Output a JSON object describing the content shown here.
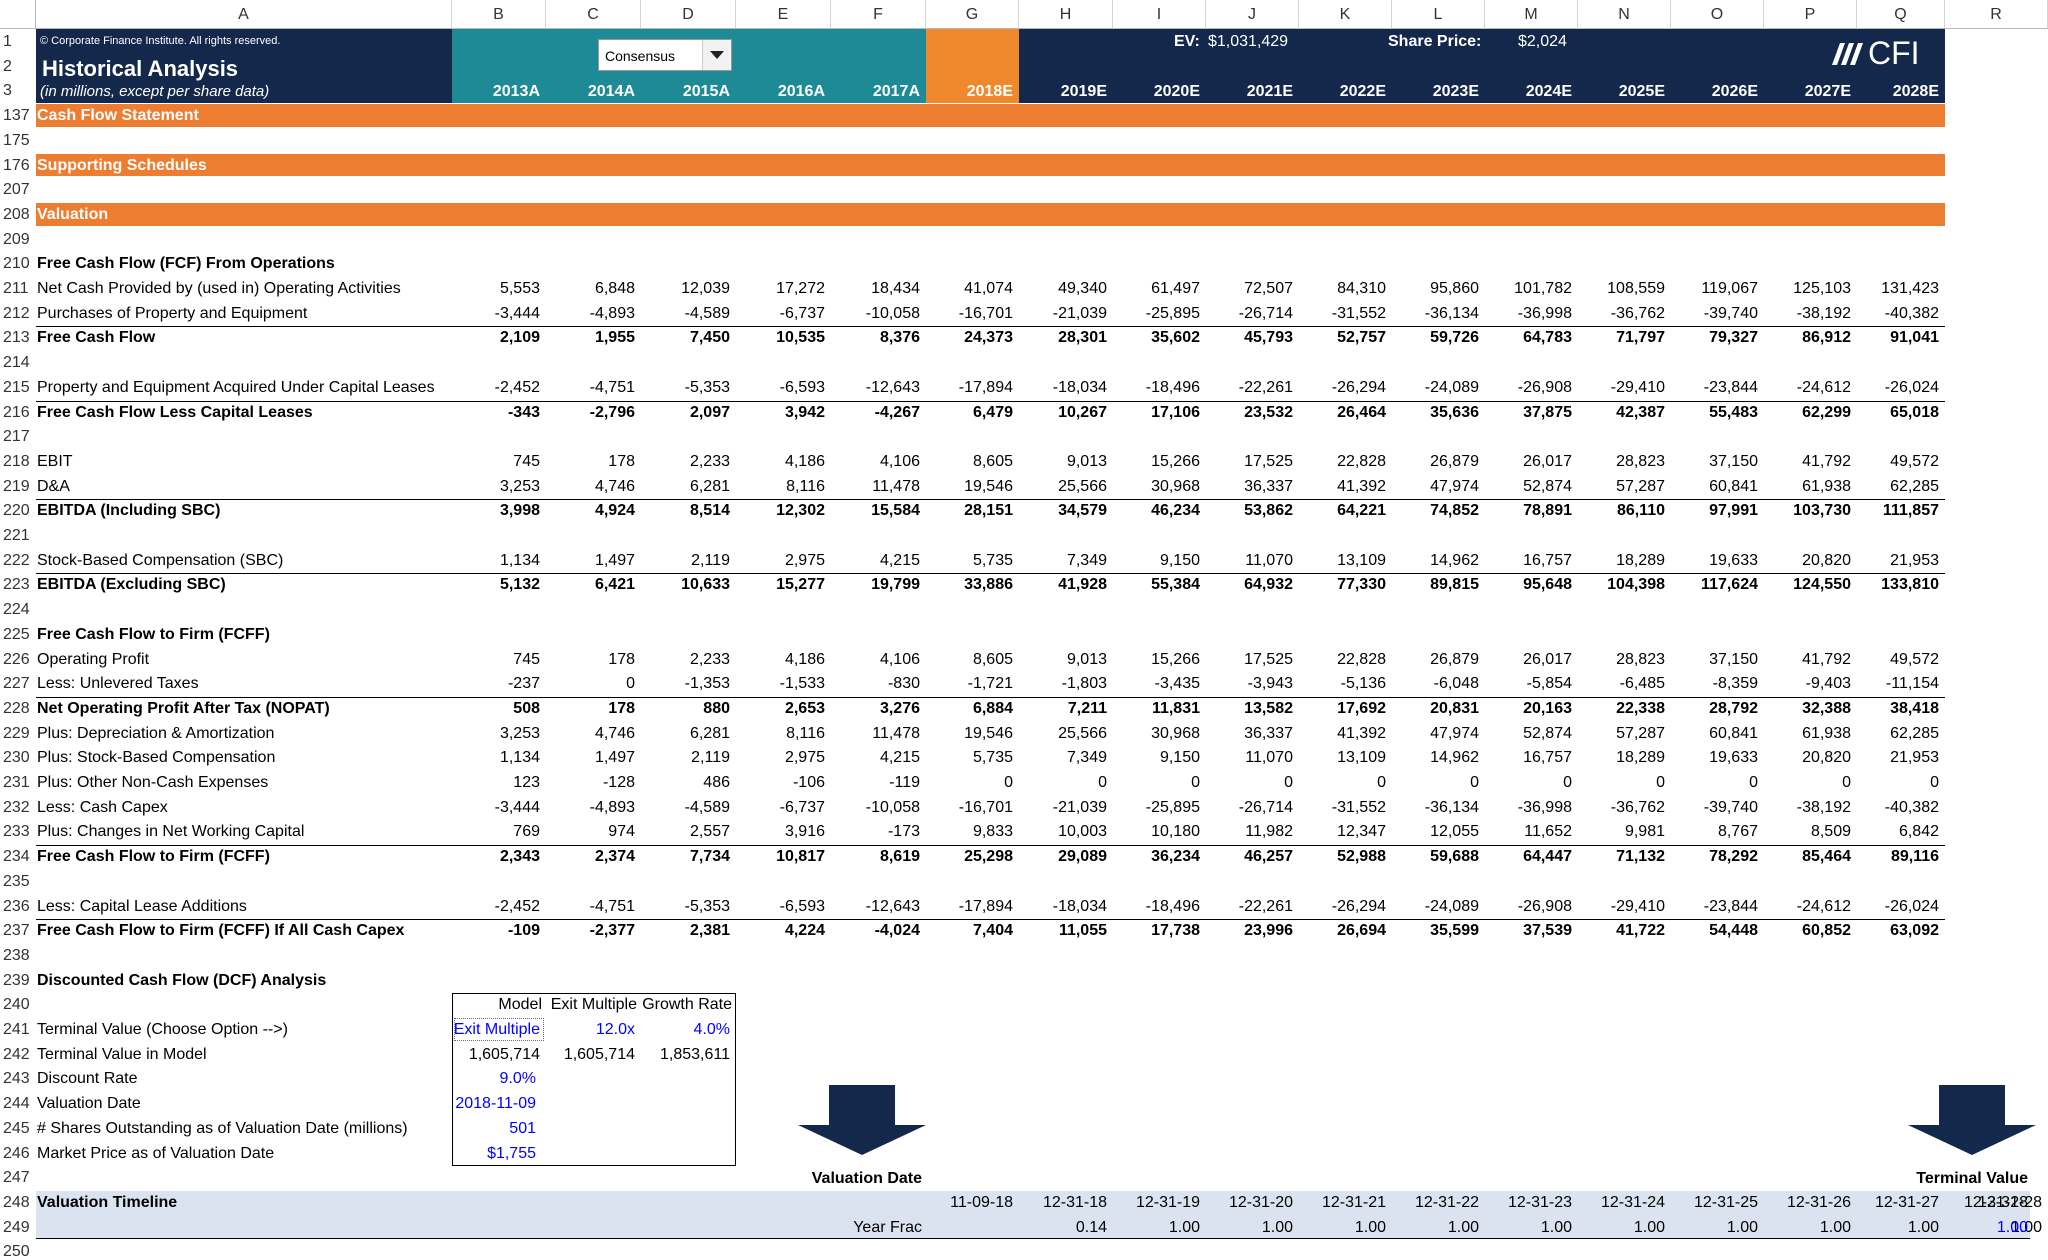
{
  "sheet": {
    "copyright": "© Corporate Finance Institute. All rights reserved.",
    "title": "Historical Analysis",
    "subtitle": "(in millions, except per share data)",
    "dropdown_value": "Consensus",
    "ev_label": "EV:",
    "ev_value": "$1,031,429",
    "share_price_label": "Share Price:",
    "share_price_value": "$2,024",
    "logo_text": "CFI",
    "columns": [
      "A",
      "B",
      "C",
      "D",
      "E",
      "F",
      "G",
      "H",
      "I",
      "J",
      "K",
      "L",
      "M",
      "N",
      "O",
      "P",
      "Q",
      "R"
    ],
    "years": [
      "2013A",
      "2014A",
      "2015A",
      "2016A",
      "2017A",
      "2018E",
      "2019E",
      "2020E",
      "2021E",
      "2022E",
      "2023E",
      "2024E",
      "2025E",
      "2026E",
      "2027E",
      "2028E"
    ],
    "colors": {
      "navy": "#14284b",
      "teal": "#1d8a96",
      "orange": "#f0882c",
      "section": "#ed7d31",
      "timeline": "#dce3f0"
    }
  },
  "sections": [
    {
      "row": "137",
      "label": "Cash Flow Statement"
    },
    {
      "row": "176",
      "label": "Supporting Schedules"
    },
    {
      "row": "208",
      "label": "Valuation"
    }
  ],
  "rows": [
    {
      "row": "1"
    },
    {
      "row": "2"
    },
    {
      "row": "3"
    },
    {
      "row": "137"
    },
    {
      "row": "175"
    },
    {
      "row": "176"
    },
    {
      "row": "207"
    },
    {
      "row": "208"
    },
    {
      "row": "209"
    },
    {
      "row": "210",
      "label": "Free Cash Flow (FCF) From Operations",
      "bold": true
    },
    {
      "row": "211",
      "label": "Net Cash Provided by (used in) Operating Activities",
      "values": [
        "5,553",
        "6,848",
        "12,039",
        "17,272",
        "18,434",
        "41,074",
        "49,340",
        "61,497",
        "72,507",
        "84,310",
        "95,860",
        "101,782",
        "108,559",
        "119,067",
        "125,103",
        "131,423"
      ]
    },
    {
      "row": "212",
      "label": "Purchases of Property and Equipment",
      "values": [
        "-3,444",
        "-4,893",
        "-4,589",
        "-6,737",
        "-10,058",
        "-16,701",
        "-21,039",
        "-25,895",
        "-26,714",
        "-31,552",
        "-36,134",
        "-36,998",
        "-36,762",
        "-39,740",
        "-38,192",
        "-40,382"
      ]
    },
    {
      "row": "213",
      "label": "Free Cash Flow",
      "bold": true,
      "line": true,
      "values": [
        "2,109",
        "1,955",
        "7,450",
        "10,535",
        "8,376",
        "24,373",
        "28,301",
        "35,602",
        "45,793",
        "52,757",
        "59,726",
        "64,783",
        "71,797",
        "79,327",
        "86,912",
        "91,041"
      ]
    },
    {
      "row": "214"
    },
    {
      "row": "215",
      "label": "Property and Equipment Acquired Under Capital Leases",
      "values": [
        "-2,452",
        "-4,751",
        "-5,353",
        "-6,593",
        "-12,643",
        "-17,894",
        "-18,034",
        "-18,496",
        "-22,261",
        "-26,294",
        "-24,089",
        "-26,908",
        "-29,410",
        "-23,844",
        "-24,612",
        "-26,024"
      ]
    },
    {
      "row": "216",
      "label": "Free Cash Flow Less Capital Leases",
      "bold": true,
      "line": true,
      "values": [
        "-343",
        "-2,796",
        "2,097",
        "3,942",
        "-4,267",
        "6,479",
        "10,267",
        "17,106",
        "23,532",
        "26,464",
        "35,636",
        "37,875",
        "42,387",
        "55,483",
        "62,299",
        "65,018"
      ]
    },
    {
      "row": "217"
    },
    {
      "row": "218",
      "label": "EBIT",
      "values": [
        "745",
        "178",
        "2,233",
        "4,186",
        "4,106",
        "8,605",
        "9,013",
        "15,266",
        "17,525",
        "22,828",
        "26,879",
        "26,017",
        "28,823",
        "37,150",
        "41,792",
        "49,572"
      ]
    },
    {
      "row": "219",
      "label": "D&A",
      "values": [
        "3,253",
        "4,746",
        "6,281",
        "8,116",
        "11,478",
        "19,546",
        "25,566",
        "30,968",
        "36,337",
        "41,392",
        "47,974",
        "52,874",
        "57,287",
        "60,841",
        "61,938",
        "62,285"
      ]
    },
    {
      "row": "220",
      "label": "EBITDA (Including SBC)",
      "bold": true,
      "line": true,
      "values": [
        "3,998",
        "4,924",
        "8,514",
        "12,302",
        "15,584",
        "28,151",
        "34,579",
        "46,234",
        "53,862",
        "64,221",
        "74,852",
        "78,891",
        "86,110",
        "97,991",
        "103,730",
        "111,857"
      ]
    },
    {
      "row": "221"
    },
    {
      "row": "222",
      "label": "Stock-Based Compensation (SBC)",
      "values": [
        "1,134",
        "1,497",
        "2,119",
        "2,975",
        "4,215",
        "5,735",
        "7,349",
        "9,150",
        "11,070",
        "13,109",
        "14,962",
        "16,757",
        "18,289",
        "19,633",
        "20,820",
        "21,953"
      ]
    },
    {
      "row": "223",
      "label": "EBITDA (Excluding SBC)",
      "bold": true,
      "line": true,
      "values": [
        "5,132",
        "6,421",
        "10,633",
        "15,277",
        "19,799",
        "33,886",
        "41,928",
        "55,384",
        "64,932",
        "77,330",
        "89,815",
        "95,648",
        "104,398",
        "117,624",
        "124,550",
        "133,810"
      ]
    },
    {
      "row": "224"
    },
    {
      "row": "225",
      "label": "Free Cash Flow to Firm (FCFF)",
      "bold": true
    },
    {
      "row": "226",
      "label": "Operating Profit",
      "values": [
        "745",
        "178",
        "2,233",
        "4,186",
        "4,106",
        "8,605",
        "9,013",
        "15,266",
        "17,525",
        "22,828",
        "26,879",
        "26,017",
        "28,823",
        "37,150",
        "41,792",
        "49,572"
      ]
    },
    {
      "row": "227",
      "label": "Less: Unlevered Taxes",
      "values": [
        "-237",
        "0",
        "-1,353",
        "-1,533",
        "-830",
        "-1,721",
        "-1,803",
        "-3,435",
        "-3,943",
        "-5,136",
        "-6,048",
        "-5,854",
        "-6,485",
        "-8,359",
        "-9,403",
        "-11,154"
      ]
    },
    {
      "row": "228",
      "label": "Net Operating Profit After Tax (NOPAT)",
      "bold": true,
      "line": true,
      "values": [
        "508",
        "178",
        "880",
        "2,653",
        "3,276",
        "6,884",
        "7,211",
        "11,831",
        "13,582",
        "17,692",
        "20,831",
        "20,163",
        "22,338",
        "28,792",
        "32,388",
        "38,418"
      ]
    },
    {
      "row": "229",
      "label": "Plus: Depreciation & Amortization",
      "values": [
        "3,253",
        "4,746",
        "6,281",
        "8,116",
        "11,478",
        "19,546",
        "25,566",
        "30,968",
        "36,337",
        "41,392",
        "47,974",
        "52,874",
        "57,287",
        "60,841",
        "61,938",
        "62,285"
      ]
    },
    {
      "row": "230",
      "label": "Plus: Stock-Based Compensation",
      "values": [
        "1,134",
        "1,497",
        "2,119",
        "2,975",
        "4,215",
        "5,735",
        "7,349",
        "9,150",
        "11,070",
        "13,109",
        "14,962",
        "16,757",
        "18,289",
        "19,633",
        "20,820",
        "21,953"
      ]
    },
    {
      "row": "231",
      "label": "Plus: Other Non-Cash Expenses",
      "values": [
        "123",
        "-128",
        "486",
        "-106",
        "-119",
        "0",
        "0",
        "0",
        "0",
        "0",
        "0",
        "0",
        "0",
        "0",
        "0",
        "0"
      ]
    },
    {
      "row": "232",
      "label": "Less: Cash Capex",
      "values": [
        "-3,444",
        "-4,893",
        "-4,589",
        "-6,737",
        "-10,058",
        "-16,701",
        "-21,039",
        "-25,895",
        "-26,714",
        "-31,552",
        "-36,134",
        "-36,998",
        "-36,762",
        "-39,740",
        "-38,192",
        "-40,382"
      ]
    },
    {
      "row": "233",
      "label": "Plus: Changes in Net Working Capital",
      "values": [
        "769",
        "974",
        "2,557",
        "3,916",
        "-173",
        "9,833",
        "10,003",
        "10,180",
        "11,982",
        "12,347",
        "12,055",
        "11,652",
        "9,981",
        "8,767",
        "8,509",
        "6,842"
      ]
    },
    {
      "row": "234",
      "label": "Free Cash Flow to Firm (FCFF)",
      "bold": true,
      "line": true,
      "values": [
        "2,343",
        "2,374",
        "7,734",
        "10,817",
        "8,619",
        "25,298",
        "29,089",
        "36,234",
        "46,257",
        "52,988",
        "59,688",
        "64,447",
        "71,132",
        "78,292",
        "85,464",
        "89,116"
      ]
    },
    {
      "row": "235"
    },
    {
      "row": "236",
      "label": "Less: Capital Lease Additions",
      "values": [
        "-2,452",
        "-4,751",
        "-5,353",
        "-6,593",
        "-12,643",
        "-17,894",
        "-18,034",
        "-18,496",
        "-22,261",
        "-26,294",
        "-24,089",
        "-26,908",
        "-29,410",
        "-23,844",
        "-24,612",
        "-26,024"
      ]
    },
    {
      "row": "237",
      "label": "Free Cash Flow to Firm (FCFF) If All Cash Capex",
      "bold": true,
      "line": true,
      "values": [
        "-109",
        "-2,377",
        "2,381",
        "4,224",
        "-4,024",
        "7,404",
        "11,055",
        "17,738",
        "23,996",
        "26,694",
        "35,599",
        "37,539",
        "41,722",
        "54,448",
        "60,852",
        "63,092"
      ]
    },
    {
      "row": "238"
    },
    {
      "row": "239",
      "label": "Discounted Cash Flow (DCF) Analysis",
      "bold": true
    },
    {
      "row": "240"
    },
    {
      "row": "241",
      "label": "Terminal Value (Choose Option -->)"
    },
    {
      "row": "242",
      "label": "Terminal Value in Model"
    },
    {
      "row": "243",
      "label": "Discount Rate"
    },
    {
      "row": "244",
      "label": "Valuation Date"
    },
    {
      "row": "245",
      "label": "# Shares Outstanding as of Valuation Date (millions)"
    },
    {
      "row": "246",
      "label": "Market Price as of Valuation Date"
    },
    {
      "row": "247"
    },
    {
      "row": "248",
      "label": "Valuation Timeline",
      "bold": true
    },
    {
      "row": "249"
    },
    {
      "row": "250"
    }
  ],
  "dcf": {
    "headers": [
      "Model",
      "Exit Multiple",
      "Growth Rate"
    ],
    "terminal_option": [
      "Exit Multiple",
      "12.0x",
      "4.0%"
    ],
    "terminal_value": [
      "1,605,714",
      "1,605,714",
      "1,853,611"
    ],
    "discount_rate": "9.0%",
    "valuation_date": "2018-11-09",
    "shares_outstanding": "501",
    "market_price": "$1,755"
  },
  "timeline": {
    "valuation_date_label": "Valuation Date",
    "terminal_value_label": "Terminal Value",
    "year_frac_label": "Year Frac",
    "dates": [
      "11-09-18",
      "12-31-18",
      "12-31-19",
      "12-31-20",
      "12-31-21",
      "12-31-22",
      "12-31-23",
      "12-31-24",
      "12-31-25",
      "12-31-26",
      "12-31-27",
      "12-31-28",
      "12-31-28"
    ],
    "fracs": [
      "0.14",
      "1.00",
      "1.00",
      "1.00",
      "1.00",
      "1.00",
      "1.00",
      "1.00",
      "1.00",
      "1.00",
      "1.00",
      "1.00"
    ]
  }
}
